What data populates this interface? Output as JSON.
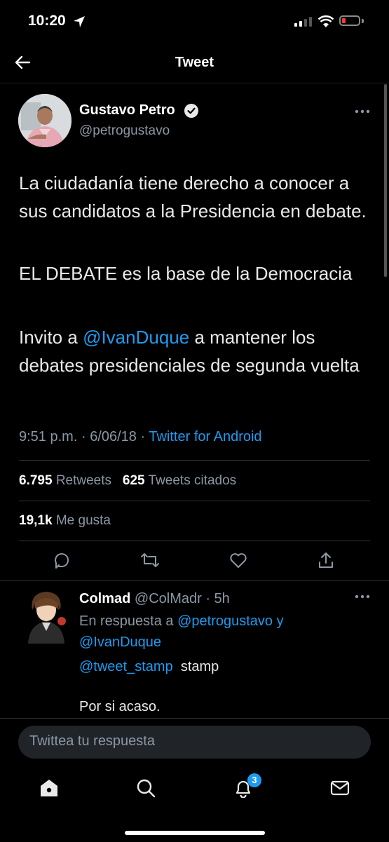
{
  "status_bar": {
    "time": "10:20"
  },
  "header": {
    "title": "Tweet"
  },
  "author": {
    "name": "Gustavo Petro",
    "handle": "@petrogustavo"
  },
  "tweet": {
    "p1": "La ciudadanía tiene derecho a conocer a sus candidatos a la Presidencia en debate.",
    "p2": "EL DEBATE es la base de la Democracia",
    "p3_before": "Invito a ",
    "p3_mention": "@IvanDuque",
    "p3_after": " a mantener los debates presidenciales de segunda vuelta",
    "time": "9:51 p.m.",
    "date": "6/06/18",
    "dot": "·",
    "source": "Twitter for Android"
  },
  "stats": {
    "retweets_count": "6.795",
    "retweets_label": "Retweets",
    "quotes_count": "625",
    "quotes_label": "Tweets citados",
    "likes_count": "19,1k",
    "likes_label": "Me gusta"
  },
  "reply": {
    "name": "Colmad",
    "handle_time": "@ColMadr · 5h",
    "replying_label": "En respuesta a",
    "replying_to_1": "@petrogustavo",
    "replying_and": "y",
    "replying_to_2": "@IvanDuque",
    "mention": "@tweet_stamp",
    "word": "stamp",
    "text": "Por si acaso."
  },
  "compose": {
    "placeholder": "Twittea tu respuesta"
  },
  "notifications_badge": "3",
  "colors": {
    "accent": "#1d9bf0",
    "background": "#000000",
    "muted": "#8b98a5"
  }
}
